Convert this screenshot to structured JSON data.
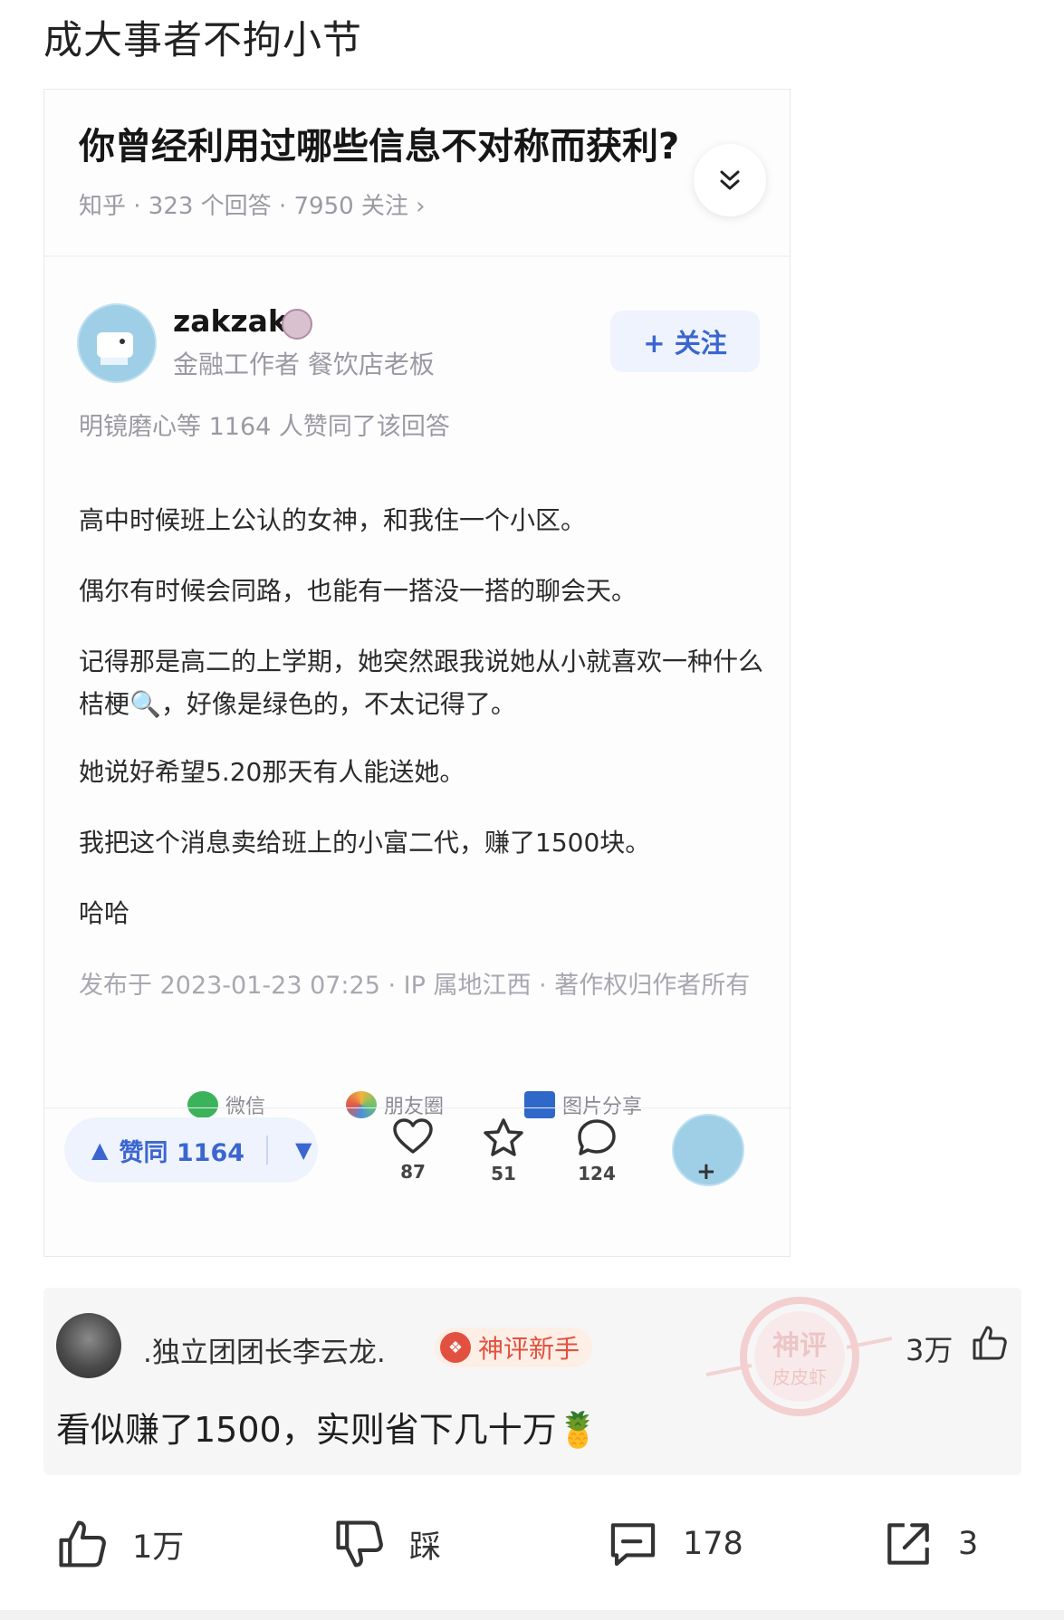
{
  "post": {
    "title": "成大事者不拘小节"
  },
  "screenshot": {
    "question_title": "你曾经利用过哪些信息不对称而获利?",
    "question_meta": "知乎 · 323 个回答 · 7950 关注 ›",
    "author": {
      "name": "zakzak",
      "description": "金融工作者 餐饮店老板",
      "follow_label": "+ 关注"
    },
    "agree_line": "明镜磨心等 1164 人赞同了该回答",
    "answer": {
      "p1": "高中时候班上公认的女神，和我住一个小区。",
      "p2": "偶尔有时候会同路，也能有一搭没一搭的聊会天。",
      "p3": "记得那是高二的上学期，她突然跟我说她从小就喜欢一种什么桔梗🔍，好像是绿色的，不太记得了。",
      "p4": "她说好希望5.20那天有人能送她。",
      "p5": "我把这个消息卖给班上的小富二代，赚了1500块。",
      "p6": "哈哈"
    },
    "published": "发布于 2023-01-23 07:25 · IP 属地江西 · 著作权归作者所有",
    "share": {
      "wechat": "微信",
      "moments": "朋友圈",
      "image": "图片分享"
    },
    "bottom_bar": {
      "vote_label": "赞同 1164",
      "likes": "87",
      "favorites": "51",
      "comments": "124"
    }
  },
  "comment": {
    "user": ".独立团团长李云龙.",
    "badge": "神评新手",
    "likes": "3万",
    "text": "看似赚了1500，实则省下几十万🍍",
    "stamp_top": "神评",
    "stamp_bottom": "皮皮虾"
  },
  "footer": {
    "like_count": "1万",
    "dislike_label": "踩",
    "comment_count": "178",
    "share_count": "3"
  },
  "colors": {
    "accent_blue": "#3b66d0",
    "badge_red": "#e2513f"
  }
}
